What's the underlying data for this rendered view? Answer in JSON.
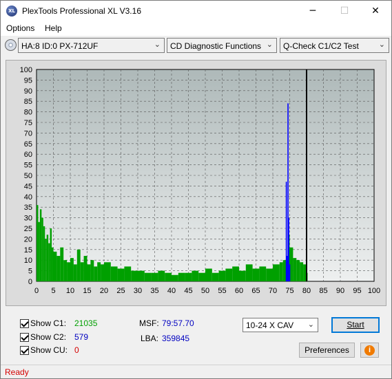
{
  "window": {
    "title": "PlexTools Professional XL V3.16",
    "icon_text": "XL",
    "minimize": "─",
    "maximize": "☐",
    "close": "✕"
  },
  "menu": {
    "options": "Options",
    "help": "Help"
  },
  "toolbar": {
    "drive": "HA:8 ID:0  PX-712UF",
    "function": "CD Diagnostic Functions",
    "test": "Q-Check C1/C2 Test"
  },
  "chart_data": {
    "type": "bar",
    "x_ticks": [
      0,
      5,
      10,
      15,
      20,
      25,
      30,
      35,
      40,
      45,
      50,
      55,
      60,
      65,
      70,
      75,
      80,
      85,
      90,
      95,
      100
    ],
    "y_ticks": [
      0,
      5,
      10,
      15,
      20,
      25,
      30,
      35,
      40,
      45,
      50,
      55,
      60,
      65,
      70,
      75,
      80,
      85,
      90,
      95,
      100
    ],
    "xlim": [
      0,
      100
    ],
    "ylim": [
      0,
      100
    ],
    "grid": true,
    "end_marker_x": 80,
    "colors": {
      "c1": "#00a000",
      "c2": "#0000ff",
      "plot_bg": "#aeb9b9",
      "plot_bg_light": "#eef0f0"
    },
    "series": [
      {
        "key": "c1",
        "x": [
          0,
          0.5,
          1,
          1.5,
          2,
          2.5,
          3,
          3.5,
          4,
          4.5,
          5,
          6,
          7,
          8,
          9,
          10,
          11,
          12,
          13,
          14,
          15,
          16,
          17,
          18,
          19,
          20,
          22,
          24,
          26,
          28,
          30,
          32,
          34,
          36,
          38,
          40,
          42,
          44,
          46,
          48,
          50,
          52,
          54,
          56,
          58,
          60,
          62,
          64,
          66,
          68,
          70,
          72,
          73,
          74,
          74.5,
          75,
          76,
          77,
          78,
          79,
          80
        ],
        "values": [
          36,
          28,
          34,
          30,
          26,
          20,
          22,
          18,
          25,
          16,
          14,
          12,
          16,
          10,
          9,
          11,
          8,
          15,
          9,
          12,
          8,
          10,
          7,
          9,
          8,
          9,
          7,
          6,
          7,
          5,
          5,
          4,
          4,
          5,
          4,
          3,
          4,
          4,
          5,
          4,
          6,
          4,
          5,
          6,
          7,
          5,
          8,
          6,
          7,
          6,
          8,
          9,
          10,
          12,
          22,
          16,
          11,
          10,
          9,
          8,
          4
        ]
      },
      {
        "key": "c2",
        "x": [
          74,
          74.3,
          74.5,
          74.7,
          75
        ],
        "values": [
          47,
          12,
          84,
          30,
          8
        ]
      }
    ]
  },
  "stats": {
    "show_c1": "Show C1:",
    "c1_value": "21035",
    "show_c2": "Show C2:",
    "c2_value": "579",
    "show_cu": "Show CU:",
    "cu_value": "0",
    "msf_label": "MSF:",
    "msf_value": "79:57.70",
    "lba_label": "LBA:",
    "lba_value": "359845"
  },
  "controls": {
    "speed": "10-24 X CAV",
    "start": "Start",
    "preferences": "Preferences",
    "info_icon": "i"
  },
  "status": {
    "text": "Ready"
  }
}
